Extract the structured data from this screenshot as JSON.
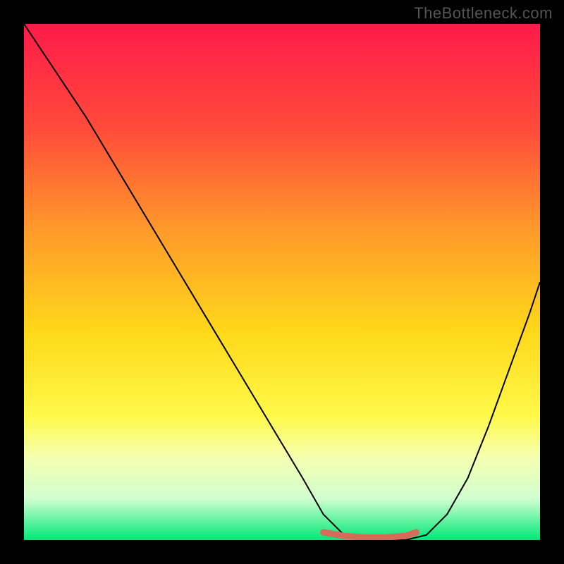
{
  "watermark": "TheBottleneck.com",
  "chart_data": {
    "type": "line",
    "title": "",
    "xlabel": "",
    "ylabel": "",
    "xlim": [
      0,
      100
    ],
    "ylim": [
      0,
      100
    ],
    "gradient_stops": [
      {
        "offset": 0,
        "color": "#ff1a4a"
      },
      {
        "offset": 20,
        "color": "#ff4a3a"
      },
      {
        "offset": 40,
        "color": "#ff9a2a"
      },
      {
        "offset": 60,
        "color": "#ffd91a"
      },
      {
        "offset": 76,
        "color": "#fff94a"
      },
      {
        "offset": 84,
        "color": "#f5ffb0"
      },
      {
        "offset": 92,
        "color": "#d0ffd0"
      },
      {
        "offset": 100,
        "color": "#00e878"
      }
    ],
    "series": [
      {
        "name": "bottleneck-curve",
        "color": "#000000",
        "stroke_width": 2,
        "x": [
          0,
          6,
          12,
          18,
          24,
          30,
          36,
          42,
          48,
          54,
          58,
          62,
          66,
          70,
          74,
          78,
          82,
          86,
          90,
          94,
          98,
          100
        ],
        "values": [
          100,
          91,
          82,
          72,
          62,
          52,
          42,
          32,
          22,
          12,
          5,
          1,
          0,
          0,
          0,
          1,
          5,
          12,
          22,
          33,
          44,
          50
        ]
      },
      {
        "name": "bottom-marker",
        "color": "#d86a5a",
        "stroke_width": 9,
        "linecap": "round",
        "x": [
          58,
          62,
          66,
          70,
          74,
          76
        ],
        "values": [
          1.5,
          0.8,
          0.5,
          0.5,
          0.8,
          1.5
        ]
      }
    ]
  }
}
